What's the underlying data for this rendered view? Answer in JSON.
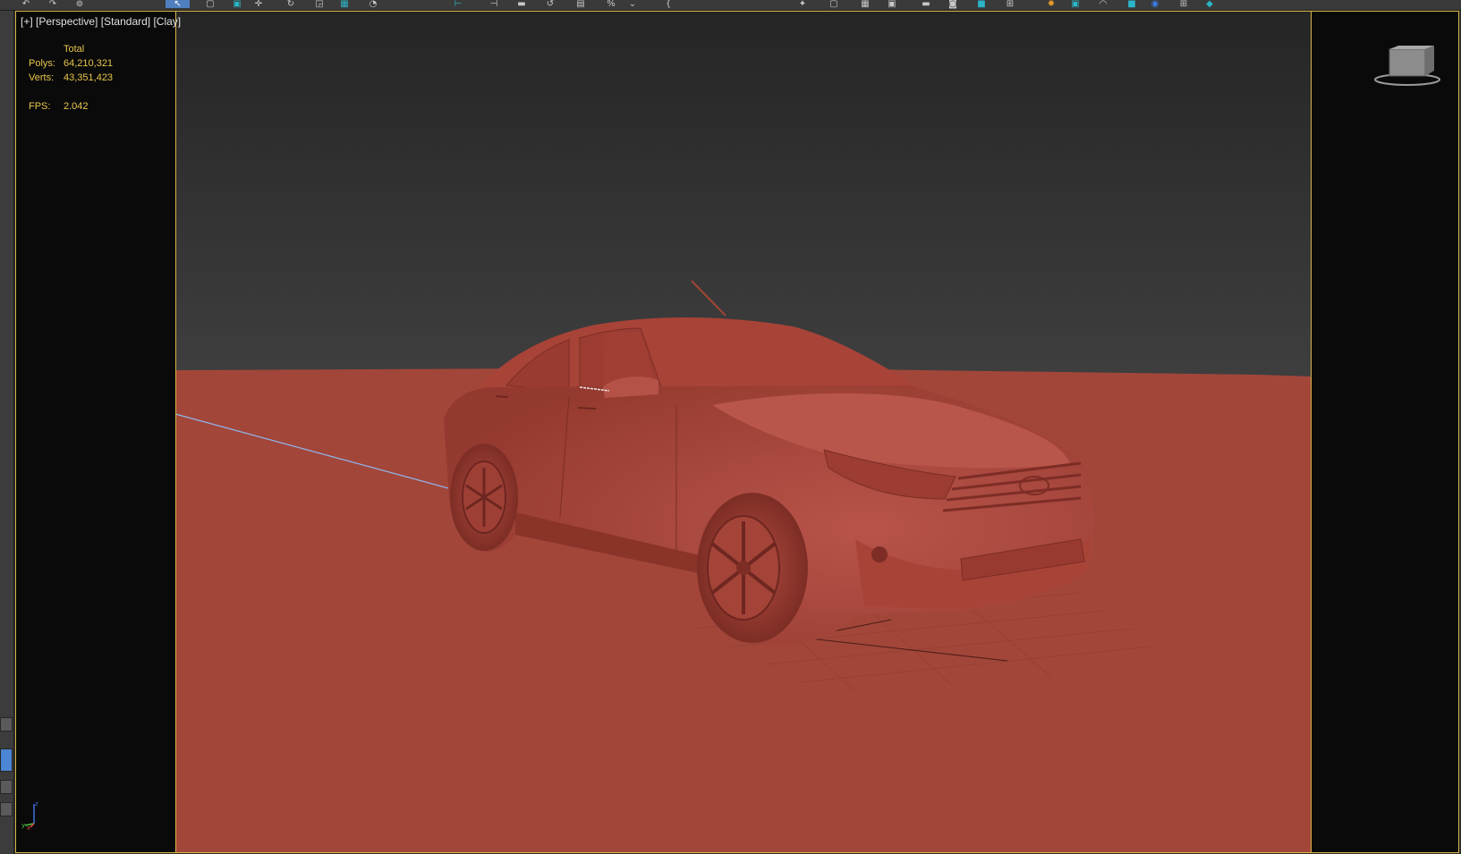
{
  "toolbar": {
    "icons": [
      "undo-icon",
      "redo-icon",
      "link-icon",
      "select-icon",
      "select-region-icon",
      "window-crossing-icon",
      "move-icon",
      "rotate-icon",
      "scale-icon",
      "snap-icon",
      "angle-snap-icon",
      "percent-snap-icon",
      "spinner-snap-icon",
      "mirror-icon",
      "align-icon",
      "layer-icon",
      "graphite-icon",
      "curve-editor-icon",
      "schematic-icon",
      "material-editor-icon",
      "render-setup-icon",
      "rendered-frame-icon",
      "render-icon"
    ]
  },
  "viewport": {
    "labels": {
      "plus": "[+]",
      "view": "[Perspective]",
      "shading_style": "[Standard]",
      "shading_mode": "[Clay]"
    },
    "stats": {
      "header": "Total",
      "polys_label": "Polys:",
      "polys_value": "64,210,321",
      "verts_label": "Verts:",
      "verts_value": "43,351,423",
      "fps_label": "FPS:",
      "fps_value": "2.042"
    },
    "colors": {
      "background": "#2b2b2b",
      "ground": "#a2463a",
      "clay": "#b04c40",
      "frame": "#d9b54a",
      "stats_text": "#e8c64a"
    },
    "viewcube_icon": "viewcube-icon",
    "axis_labels": {
      "z": "z",
      "y": "y",
      "x": "x"
    }
  }
}
